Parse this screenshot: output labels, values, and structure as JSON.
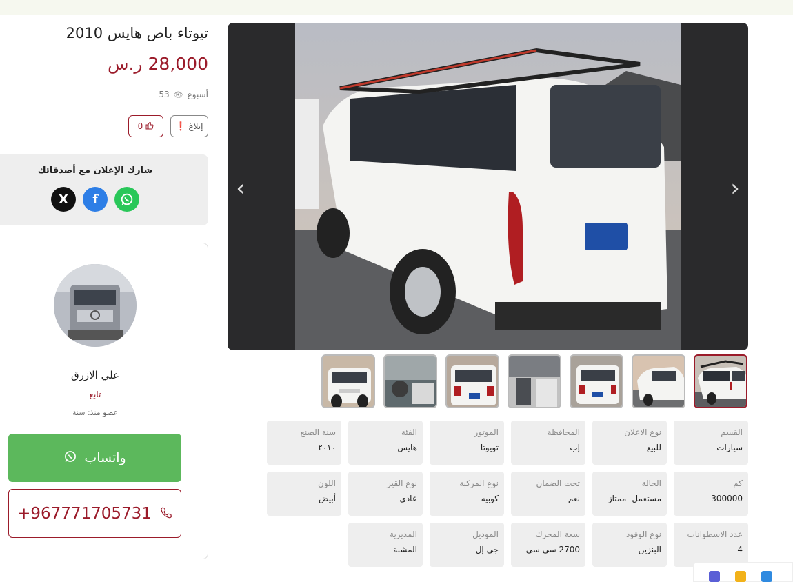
{
  "listing": {
    "title": "تيوتاء باص هايس 2010",
    "price": "28,000 ر.س",
    "time_ago": "أسبوع",
    "views": "53",
    "likes": "0",
    "report_label": "إبلاغ"
  },
  "share": {
    "title": "شارك الإعلان مع أصدقائك",
    "icons": [
      "x-icon",
      "facebook-icon",
      "whatsapp-icon"
    ]
  },
  "seller": {
    "name": "علي الازرق",
    "follow_label": "تابع",
    "member_since": "عضو منذ: سنة",
    "whatsapp_label": "واتساب",
    "phone": "+967771705731"
  },
  "gallery": {
    "thumbnail_count": 7,
    "active_index": 0
  },
  "specs": [
    {
      "label": "القسم",
      "value": "سيارات"
    },
    {
      "label": "نوع الاعلان",
      "value": "للبيع"
    },
    {
      "label": "المحافظة",
      "value": "إب"
    },
    {
      "label": "الموتور",
      "value": "تويوتا"
    },
    {
      "label": "الفئة",
      "value": "هايس"
    },
    {
      "label": "سنة الصنع",
      "value": "٢٠١٠"
    },
    {
      "label": "كم",
      "value": "300000"
    },
    {
      "label": "الحالة",
      "value": "مستعمل- ممتاز"
    },
    {
      "label": "تحت الضمان",
      "value": "نعم"
    },
    {
      "label": "نوع المركبة",
      "value": "كوبيه"
    },
    {
      "label": "نوع القير",
      "value": "عادي"
    },
    {
      "label": "اللون",
      "value": "أبيض"
    },
    {
      "label": "عدد الاسطوانات",
      "value": "4"
    },
    {
      "label": "نوع الوقود",
      "value": "البنزين"
    },
    {
      "label": "سعة المحرك",
      "value": "2700 سي سي"
    },
    {
      "label": "الموديل",
      "value": "جي إل"
    },
    {
      "label": "المديرية",
      "value": "المشنة"
    }
  ],
  "colors": {
    "brand": "#9b1b2a",
    "whatsapp": "#5cb85c"
  }
}
